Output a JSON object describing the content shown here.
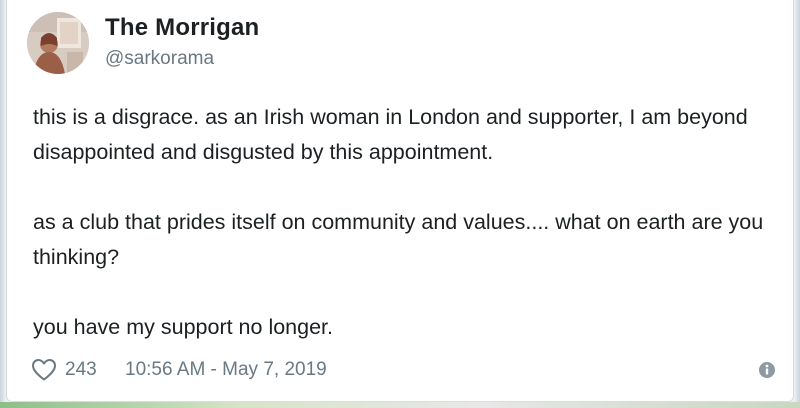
{
  "tweet": {
    "author": {
      "display_name": "The Morrigan",
      "handle": "@sarkorama",
      "avatar_icon": "profile-photo"
    },
    "paragraphs": [
      "this is a disgrace. as an Irish woman in London and supporter, I am beyond disappointed and disgusted by this appointment.",
      "as a club that prides itself on community and values.... what on earth are you thinking?",
      "you have my support no longer."
    ],
    "footer": {
      "like_icon": "heart-icon",
      "like_count": "243",
      "timestamp": "10:56 AM - May 7, 2019",
      "info_icon": "info-icon"
    }
  },
  "colors": {
    "text": "#1c2022",
    "secondary_text": "#697882",
    "card_background": "#ffffff"
  }
}
